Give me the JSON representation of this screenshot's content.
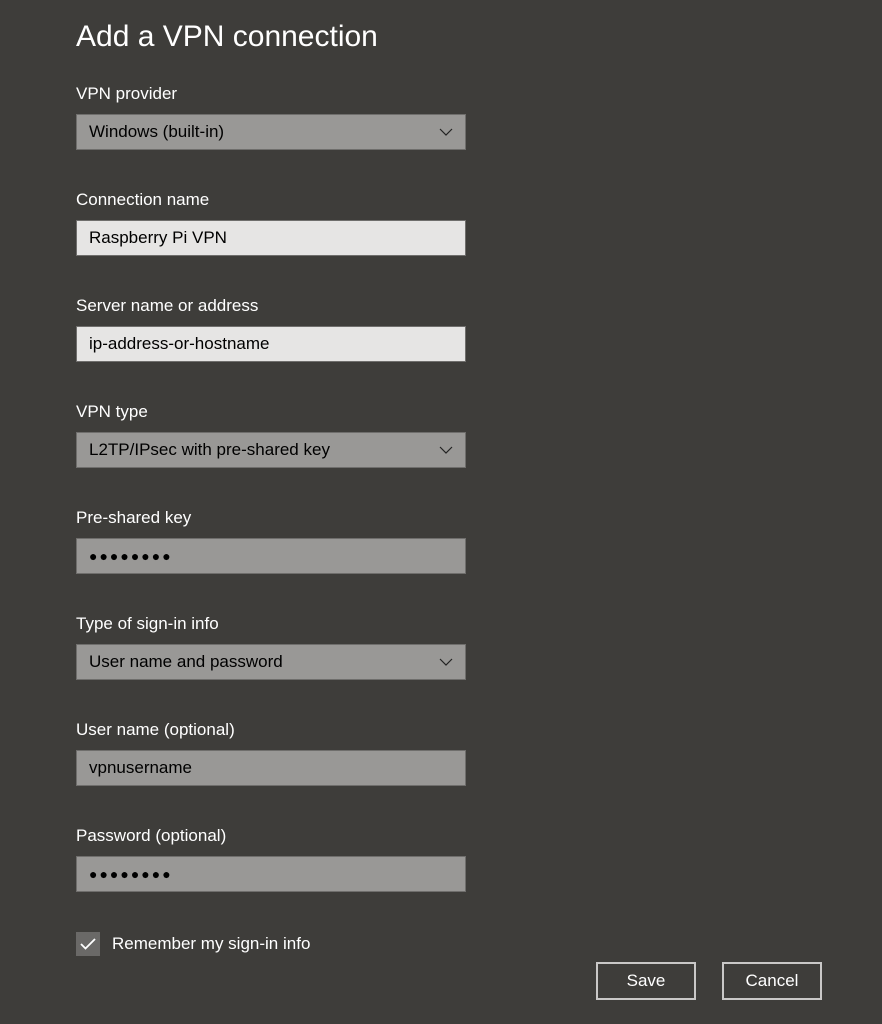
{
  "title": "Add a VPN connection",
  "fields": {
    "vpn_provider": {
      "label": "VPN provider",
      "value": "Windows (built-in)"
    },
    "connection_name": {
      "label": "Connection name",
      "value": "Raspberry Pi VPN"
    },
    "server": {
      "label": "Server name or address",
      "value": "ip-address-or-hostname"
    },
    "vpn_type": {
      "label": "VPN type",
      "value": "L2TP/IPsec with pre-shared key"
    },
    "psk": {
      "label": "Pre-shared key",
      "value": "●●●●●●●●"
    },
    "signin_type": {
      "label": "Type of sign-in info",
      "value": "User name and password"
    },
    "username": {
      "label": "User name (optional)",
      "value": "vpnusername"
    },
    "password": {
      "label": "Password (optional)",
      "value": "●●●●●●●●"
    }
  },
  "remember": {
    "label": "Remember my sign-in info",
    "checked": true
  },
  "buttons": {
    "save": "Save",
    "cancel": "Cancel"
  }
}
